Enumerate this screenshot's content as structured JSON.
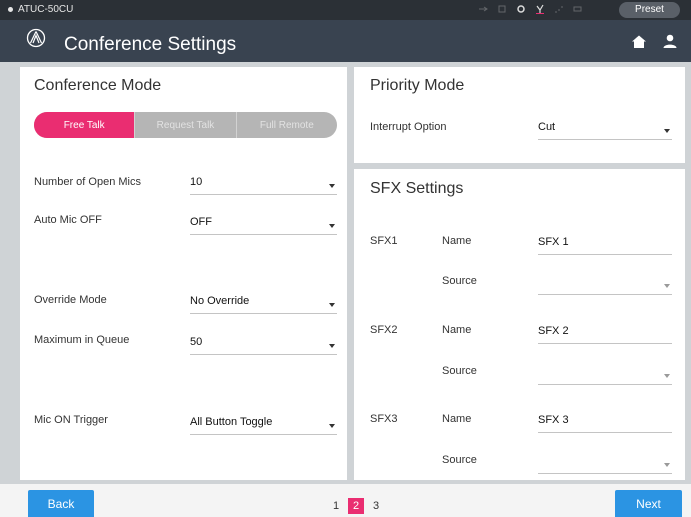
{
  "status_bar": {
    "device": "ATUC-50CU",
    "preset": "Preset"
  },
  "header": {
    "title": "Conference Settings"
  },
  "conference_mode": {
    "title": "Conference Mode",
    "modes": [
      "Free Talk",
      "Request Talk",
      "Full Remote"
    ],
    "active_mode": "Free Talk",
    "settings": [
      {
        "label": "Number of Open Mics",
        "value": "10"
      },
      {
        "label": "Auto Mic OFF",
        "value": "OFF"
      },
      {
        "label": "Override Mode",
        "value": "No Override"
      },
      {
        "label": "Maximum in Queue",
        "value": "50"
      },
      {
        "label": "Mic ON Trigger",
        "value": "All Button Toggle"
      }
    ]
  },
  "priority_mode": {
    "title": "Priority Mode",
    "label": "Interrupt Option",
    "value": "Cut"
  },
  "sfx_settings": {
    "title": "SFX Settings",
    "name_label": "Name",
    "source_label": "Source",
    "items": [
      {
        "id": "SFX1",
        "name": "SFX 1",
        "source": ""
      },
      {
        "id": "SFX2",
        "name": "SFX 2",
        "source": ""
      },
      {
        "id": "SFX3",
        "name": "SFX 3",
        "source": ""
      }
    ]
  },
  "footer": {
    "back": "Back",
    "next": "Next",
    "pages": [
      "1",
      "2",
      "3"
    ],
    "current_page": "2"
  },
  "colors": {
    "accent": "#ea2d71",
    "button": "#2b94e3",
    "header": "#394350",
    "status_bar": "#2b3036"
  }
}
